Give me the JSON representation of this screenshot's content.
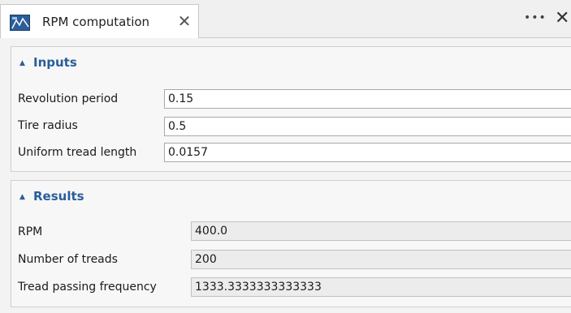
{
  "tab": {
    "title": "RPM computation",
    "icon": "rpm-app-icon",
    "close_glyph": "✕"
  },
  "toolbar": {
    "menu_glyph": "•••",
    "close_glyph": "✕"
  },
  "inputs": {
    "header": "Inputs",
    "fields": [
      {
        "label": "Revolution period",
        "value": "0.15"
      },
      {
        "label": "Tire radius",
        "value": "0.5"
      },
      {
        "label": "Uniform tread length",
        "value": "0.0157"
      }
    ]
  },
  "results": {
    "header": "Results",
    "fields": [
      {
        "label": "RPM",
        "value": "400.0"
      },
      {
        "label": "Number of treads",
        "value": "200"
      },
      {
        "label": "Tread passing frequency",
        "value": "1333.3333333333333"
      }
    ]
  },
  "colors": {
    "accent": "#2a5d9a",
    "readonly_bg": "#ececec",
    "panel_bg": "#f7f7f7"
  }
}
